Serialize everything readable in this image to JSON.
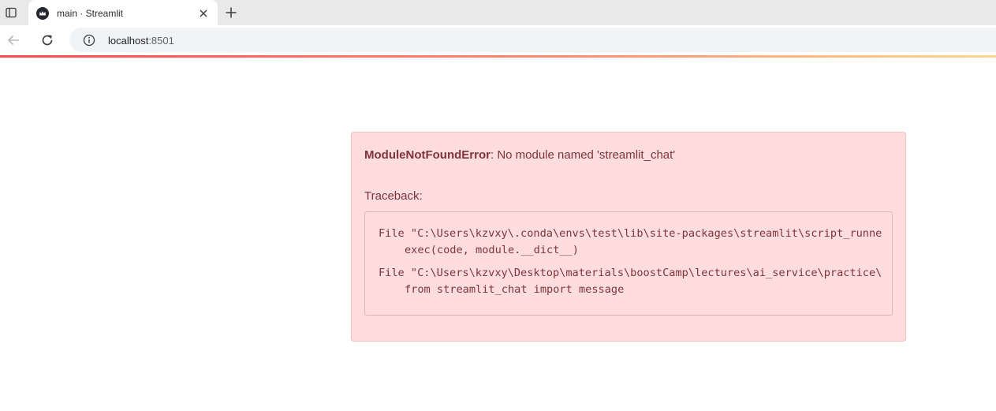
{
  "browser": {
    "tab": {
      "title": "main · Streamlit",
      "favicon": "streamlit-crown-icon"
    },
    "url": {
      "host": "localhost",
      "port": ":8501"
    },
    "icons": {
      "sidebar": "tab-sidebar-icon",
      "close": "close-icon",
      "new_tab": "plus-icon",
      "back": "back-arrow-icon",
      "reload": "reload-icon",
      "info": "info-icon"
    }
  },
  "error": {
    "name": "ModuleNotFoundError",
    "message": ": No module named 'streamlit_chat'",
    "traceback_label": "Traceback:",
    "trace_lines": [
      "File \"C:\\Users\\kzvxy\\.conda\\envs\\test\\lib\\site-packages\\streamlit\\script_runne",
      "exec(code, module.__dict__)",
      "File \"C:\\Users\\kzvxy\\Desktop\\materials\\boostCamp\\lectures\\ai_service\\practice\\",
      "from streamlit_chat import message"
    ]
  },
  "colors": {
    "alert_bg": "#ffdcdd",
    "alert_text": "#7d353b",
    "accent": "#ff4b4b"
  }
}
